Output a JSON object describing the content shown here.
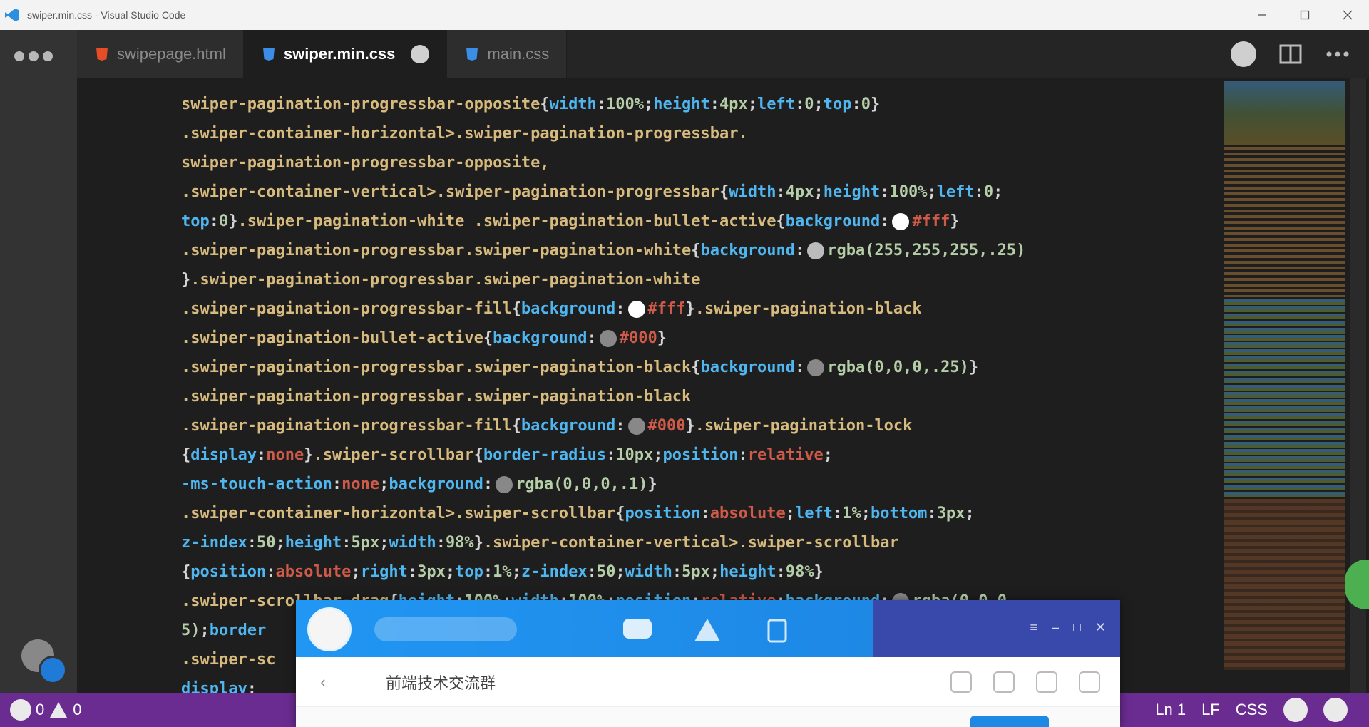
{
  "window": {
    "title": "swiper.min.css - Visual Studio Code"
  },
  "tabs": [
    {
      "label": "swipepage.html",
      "icon": "html-file-icon",
      "color": "#e44d26",
      "active": false
    },
    {
      "label": "swiper.min.css",
      "icon": "css-file-icon",
      "color": "#3a8ee6",
      "active": true
    },
    {
      "label": "main.css",
      "icon": "css-file-icon",
      "color": "#3a8ee6",
      "active": false
    }
  ],
  "code_lines": [
    [
      [
        "sel",
        "swiper-pagination-progressbar-opposite"
      ],
      [
        "punc",
        "{"
      ],
      [
        "prop",
        "width"
      ],
      [
        "punc",
        ":"
      ],
      [
        "val",
        "100%"
      ],
      [
        "punc",
        ";"
      ],
      [
        "prop",
        "height"
      ],
      [
        "punc",
        ":"
      ],
      [
        "val",
        "4px"
      ],
      [
        "punc",
        ";"
      ],
      [
        "prop",
        "left"
      ],
      [
        "punc",
        ":"
      ],
      [
        "val",
        "0"
      ],
      [
        "punc",
        ";"
      ],
      [
        "prop",
        "top"
      ],
      [
        "punc",
        ":"
      ],
      [
        "val",
        "0"
      ],
      [
        "punc",
        "}"
      ]
    ],
    [
      [
        "sel",
        ".swiper-container-horizontal>.swiper-pagination-progressbar."
      ]
    ],
    [
      [
        "sel",
        "swiper-pagination-progressbar-opposite,"
      ]
    ],
    [
      [
        "sel",
        ".swiper-container-vertical>.swiper-pagination-progressbar"
      ],
      [
        "punc",
        "{"
      ],
      [
        "prop",
        "width"
      ],
      [
        "punc",
        ":"
      ],
      [
        "val",
        "4px"
      ],
      [
        "punc",
        ";"
      ],
      [
        "prop",
        "height"
      ],
      [
        "punc",
        ":"
      ],
      [
        "val",
        "100%"
      ],
      [
        "punc",
        ";"
      ],
      [
        "prop",
        "left"
      ],
      [
        "punc",
        ":"
      ],
      [
        "val",
        "0"
      ],
      [
        "punc",
        ";"
      ]
    ],
    [
      [
        "prop",
        "top"
      ],
      [
        "punc",
        ":"
      ],
      [
        "val",
        "0"
      ],
      [
        "punc",
        "}"
      ],
      [
        "sel",
        ".swiper-pagination-white .swiper-pagination-bullet-active"
      ],
      [
        "punc",
        "{"
      ],
      [
        "prop",
        "background"
      ],
      [
        "punc",
        ":"
      ],
      [
        "swatch",
        "#ffffff"
      ],
      [
        "str",
        "#fff"
      ],
      [
        "punc",
        "}"
      ]
    ],
    [
      [
        "sel",
        ".swiper-pagination-progressbar.swiper-pagination-white"
      ],
      [
        "punc",
        "{"
      ],
      [
        "prop",
        "background"
      ],
      [
        "punc",
        ":"
      ],
      [
        "swatch",
        "#bbbbbb"
      ],
      [
        "val",
        "rgba(255,255,255,.25)"
      ]
    ],
    [
      [
        "punc",
        "}"
      ],
      [
        "sel",
        ".swiper-pagination-progressbar.swiper-pagination-white"
      ]
    ],
    [
      [
        "sel",
        ".swiper-pagination-progressbar-fill"
      ],
      [
        "punc",
        "{"
      ],
      [
        "prop",
        "background"
      ],
      [
        "punc",
        ":"
      ],
      [
        "swatch",
        "#ffffff"
      ],
      [
        "str",
        "#fff"
      ],
      [
        "punc",
        "}"
      ],
      [
        "sel",
        ".swiper-pagination-black"
      ]
    ],
    [
      [
        "sel",
        ".swiper-pagination-bullet-active"
      ],
      [
        "punc",
        "{"
      ],
      [
        "prop",
        "background"
      ],
      [
        "punc",
        ":"
      ],
      [
        "swatch",
        "#888888"
      ],
      [
        "str",
        "#000"
      ],
      [
        "punc",
        "}"
      ]
    ],
    [
      [
        "sel",
        ".swiper-pagination-progressbar.swiper-pagination-black"
      ],
      [
        "punc",
        "{"
      ],
      [
        "prop",
        "background"
      ],
      [
        "punc",
        ":"
      ],
      [
        "swatch",
        "#888888"
      ],
      [
        "val",
        "rgba(0,0,0,.25)"
      ],
      [
        "punc",
        "}"
      ]
    ],
    [
      [
        "sel",
        ".swiper-pagination-progressbar.swiper-pagination-black"
      ]
    ],
    [
      [
        "sel",
        ".swiper-pagination-progressbar-fill"
      ],
      [
        "punc",
        "{"
      ],
      [
        "prop",
        "background"
      ],
      [
        "punc",
        ":"
      ],
      [
        "swatch",
        "#888888"
      ],
      [
        "str",
        "#000"
      ],
      [
        "punc",
        "}"
      ],
      [
        "sel",
        ".swiper-pagination-lock"
      ]
    ],
    [
      [
        "punc",
        "{"
      ],
      [
        "prop",
        "display"
      ],
      [
        "punc",
        ":"
      ],
      [
        "str",
        "none"
      ],
      [
        "punc",
        "}"
      ],
      [
        "sel",
        ".swiper-scrollbar"
      ],
      [
        "punc",
        "{"
      ],
      [
        "prop",
        "border-radius"
      ],
      [
        "punc",
        ":"
      ],
      [
        "val",
        "10px"
      ],
      [
        "punc",
        ";"
      ],
      [
        "prop",
        "position"
      ],
      [
        "punc",
        ":"
      ],
      [
        "str",
        "relative"
      ],
      [
        "punc",
        ";"
      ]
    ],
    [
      [
        "prop",
        "-ms-touch-action"
      ],
      [
        "punc",
        ":"
      ],
      [
        "str",
        "none"
      ],
      [
        "punc",
        ";"
      ],
      [
        "prop",
        "background"
      ],
      [
        "punc",
        ":"
      ],
      [
        "swatch",
        "#888888"
      ],
      [
        "val",
        "rgba(0,0,0,.1)"
      ],
      [
        "punc",
        "}"
      ]
    ],
    [
      [
        "sel",
        ".swiper-container-horizontal>.swiper-scrollbar"
      ],
      [
        "punc",
        "{"
      ],
      [
        "prop",
        "position"
      ],
      [
        "punc",
        ":"
      ],
      [
        "str",
        "absolute"
      ],
      [
        "punc",
        ";"
      ],
      [
        "prop",
        "left"
      ],
      [
        "punc",
        ":"
      ],
      [
        "val",
        "1%"
      ],
      [
        "punc",
        ";"
      ],
      [
        "prop",
        "bottom"
      ],
      [
        "punc",
        ":"
      ],
      [
        "val",
        "3px"
      ],
      [
        "punc",
        ";"
      ]
    ],
    [
      [
        "prop",
        "z-index"
      ],
      [
        "punc",
        ":"
      ],
      [
        "val",
        "50"
      ],
      [
        "punc",
        ";"
      ],
      [
        "prop",
        "height"
      ],
      [
        "punc",
        ":"
      ],
      [
        "val",
        "5px"
      ],
      [
        "punc",
        ";"
      ],
      [
        "prop",
        "width"
      ],
      [
        "punc",
        ":"
      ],
      [
        "val",
        "98%"
      ],
      [
        "punc",
        "}"
      ],
      [
        "sel",
        ".swiper-container-vertical>.swiper-scrollbar"
      ]
    ],
    [
      [
        "punc",
        "{"
      ],
      [
        "prop",
        "position"
      ],
      [
        "punc",
        ":"
      ],
      [
        "str",
        "absolute"
      ],
      [
        "punc",
        ";"
      ],
      [
        "prop",
        "right"
      ],
      [
        "punc",
        ":"
      ],
      [
        "val",
        "3px"
      ],
      [
        "punc",
        ";"
      ],
      [
        "prop",
        "top"
      ],
      [
        "punc",
        ":"
      ],
      [
        "val",
        "1%"
      ],
      [
        "punc",
        ";"
      ],
      [
        "prop",
        "z-index"
      ],
      [
        "punc",
        ":"
      ],
      [
        "val",
        "50"
      ],
      [
        "punc",
        ";"
      ],
      [
        "prop",
        "width"
      ],
      [
        "punc",
        ":"
      ],
      [
        "val",
        "5px"
      ],
      [
        "punc",
        ";"
      ],
      [
        "prop",
        "height"
      ],
      [
        "punc",
        ":"
      ],
      [
        "val",
        "98%"
      ],
      [
        "punc",
        "}"
      ]
    ],
    [
      [
        "sel",
        ".swiper-scrollbar-drag"
      ],
      [
        "punc",
        "{"
      ],
      [
        "prop",
        "height"
      ],
      [
        "punc",
        ":"
      ],
      [
        "val",
        "100%"
      ],
      [
        "punc",
        ";"
      ],
      [
        "prop",
        "width"
      ],
      [
        "punc",
        ":"
      ],
      [
        "val",
        "100%"
      ],
      [
        "punc",
        ";"
      ],
      [
        "prop",
        "position"
      ],
      [
        "punc",
        ":"
      ],
      [
        "str",
        "relative"
      ],
      [
        "punc",
        ";"
      ],
      [
        "prop",
        "background"
      ],
      [
        "punc",
        ":"
      ],
      [
        "swatch",
        "#888888"
      ],
      [
        "val",
        "rgba(0,0,0,."
      ]
    ],
    [
      [
        "val",
        "5)"
      ],
      [
        "punc",
        ";"
      ],
      [
        "prop",
        "border"
      ]
    ],
    [
      [
        "sel",
        ".swiper-sc"
      ]
    ],
    [
      [
        "prop",
        "display"
      ],
      [
        "punc",
        ":"
      ]
    ]
  ],
  "statusbar": {
    "errors": "0",
    "warnings": "0",
    "right_items": [
      "Ln 1",
      "LF",
      "CSS"
    ]
  },
  "chat": {
    "contact_name": "前端技术交流群"
  },
  "colors": {
    "statusbar": "#6b2c91",
    "chat_header": "#1e88e5",
    "chat_header_right": "#3949ab"
  }
}
